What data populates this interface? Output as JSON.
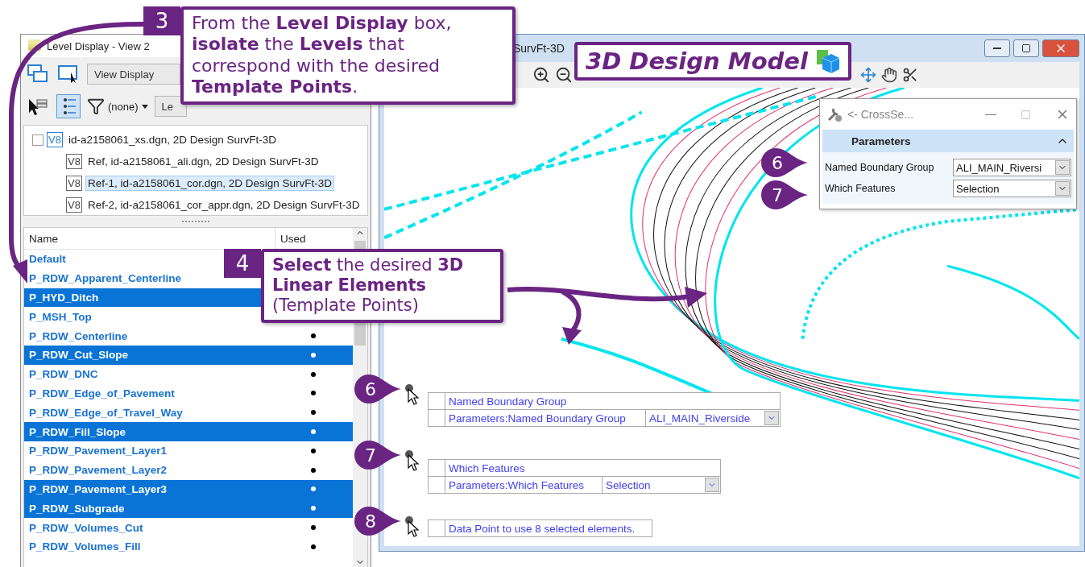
{
  "level_display": {
    "title": "Level Display - View 2",
    "view_dropdown": "View Display",
    "filter": "(none)",
    "level_dropdown": "Le",
    "tree": [
      {
        "badge": "V8",
        "label": "id-a2158061_xs.dgn, 2D Design SurvFt-3D",
        "selected": false,
        "expanded": true,
        "children": [
          {
            "badge": "V8",
            "label": "Ref, id-a2158061_ali.dgn, 2D Design SurvFt-3D",
            "selected": false
          },
          {
            "badge": "V8",
            "label": "Ref-1, id-a2158061_cor.dgn, 2D Design SurvFt-3D",
            "selected": true
          },
          {
            "badge": "V8",
            "label": "Ref-2, id-a2158061_cor_appr.dgn, 2D Design SurvFt-3D",
            "selected": false
          }
        ]
      }
    ],
    "columns": [
      "Name",
      "Used"
    ],
    "levels": [
      {
        "name": "Default",
        "selected": false
      },
      {
        "name": "P_RDW_Apparent_Centerline",
        "selected": false
      },
      {
        "name": "P_HYD_Ditch",
        "selected": true
      },
      {
        "name": "P_MSH_Top",
        "selected": false
      },
      {
        "name": "P_RDW_Centerline",
        "used": true,
        "selected": false
      },
      {
        "name": "P_RDW_Cut_Slope",
        "used": true,
        "selected": true
      },
      {
        "name": "P_RDW_DNC",
        "used": true,
        "selected": false
      },
      {
        "name": "P_RDW_Edge_of_Pavement",
        "used": true,
        "selected": false
      },
      {
        "name": "P_RDW_Edge_of_Travel_Way",
        "used": true,
        "selected": false
      },
      {
        "name": "P_RDW_Fill_Slope",
        "used": true,
        "selected": true
      },
      {
        "name": "P_RDW_Pavement_Layer1",
        "used": true,
        "selected": false
      },
      {
        "name": "P_RDW_Pavement_Layer2",
        "used": true,
        "selected": false
      },
      {
        "name": "P_RDW_Pavement_Layer3",
        "used": true,
        "selected": true
      },
      {
        "name": "P_RDW_Subgrade",
        "used": true,
        "selected": true
      },
      {
        "name": "P_RDW_Volumes_Cut",
        "used": true,
        "selected": false
      },
      {
        "name": "P_RDW_Volumes_Fill",
        "used": true,
        "selected": false
      }
    ]
  },
  "view_window": {
    "title": "SurvFt-3D"
  },
  "model_label": "3D Design Model",
  "crosssection_dialog": {
    "title": "<- CrossSe...",
    "section": "Parameters",
    "expanded": true,
    "fields": [
      {
        "label": "Named Boundary Group",
        "value": "ALI_MAIN_Riversi",
        "marker": "6"
      },
      {
        "label": "Which Features",
        "value": "Selection",
        "marker": "7"
      }
    ]
  },
  "prompts": [
    {
      "marker": "6",
      "rows": [
        {
          "label": "Named Boundary Group"
        },
        {
          "label": "Parameters:Named Boundary Group",
          "value": "ALI_MAIN_Riverside"
        }
      ]
    },
    {
      "marker": "7",
      "rows": [
        {
          "label": "Which Features"
        },
        {
          "label": "Parameters:Which Features",
          "value": "Selection"
        }
      ]
    },
    {
      "marker": "8",
      "rows": [
        {
          "label": "Data Point to use 8 selected elements."
        }
      ]
    }
  ],
  "callouts": [
    {
      "number": "3",
      "text": "From the **Level Display** box, **isolate** the **Levels** that correspond with the desired **Template Points**."
    },
    {
      "number": "4",
      "text": "**Select** the desired **3D Linear Elements** (Template Points)"
    }
  ]
}
